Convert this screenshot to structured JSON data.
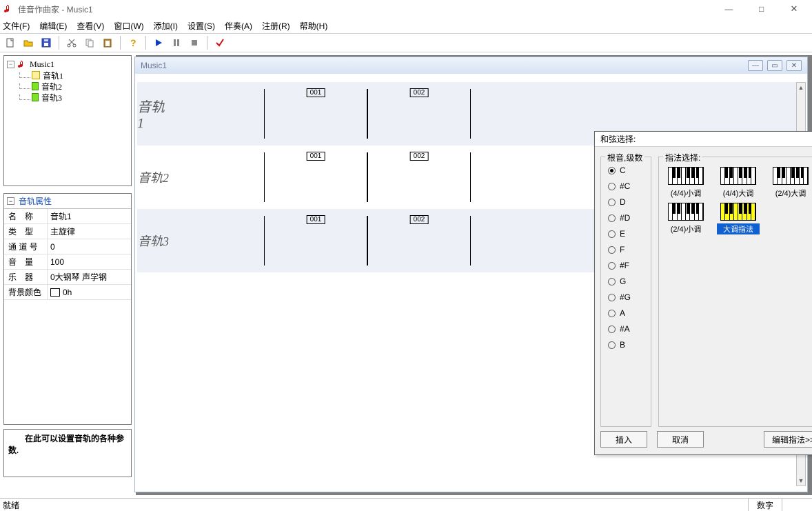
{
  "app": {
    "title": "佳音作曲家 - Music1"
  },
  "window_buttons": {
    "min": "—",
    "max": "□",
    "close": "✕"
  },
  "menu": {
    "file": "文件(F)",
    "edit": "编辑(E)",
    "view": "查看(V)",
    "window": "窗口(W)",
    "add": "添加(I)",
    "setup": "设置(S)",
    "accomp": "伴奏(A)",
    "reg": "注册(R)",
    "help": "帮助(H)"
  },
  "tree": {
    "root": "Music1",
    "items": [
      "音轨1",
      "音轨2",
      "音轨3"
    ]
  },
  "props": {
    "title": "音轨属性",
    "rows": {
      "name": {
        "k": "名　称",
        "v": "音轨1"
      },
      "type": {
        "k": "类　型",
        "v": "主旋律"
      },
      "chan": {
        "k": "通 道 号",
        "v": "0"
      },
      "vol": {
        "k": "音　量",
        "v": "100"
      },
      "instr": {
        "k": "乐　器",
        "v": "0大钢琴 声学钢"
      },
      "bg": {
        "k": "背景颜色",
        "v": "0h"
      }
    }
  },
  "hint": "　　在此可以设置音轨的各种参数.",
  "child": {
    "title": "Music1",
    "tracks": [
      {
        "label": "音轨1",
        "measures": [
          "001",
          "002"
        ]
      },
      {
        "label": "音轨2",
        "measures": [
          "001",
          "002"
        ]
      },
      {
        "label": "音轨3",
        "measures": [
          "001",
          "002"
        ]
      }
    ]
  },
  "dialog": {
    "title": "和弦选择:",
    "root_legend": "根音,级数",
    "roots": [
      "C",
      "#C",
      "D",
      "#D",
      "E",
      "F",
      "#F",
      "G",
      "#G",
      "A",
      "#A",
      "B"
    ],
    "root_selected": "C",
    "fin_legend": "指法选择:",
    "fingerings": [
      {
        "label": "(4/4)小调"
      },
      {
        "label": "(4/4)大调"
      },
      {
        "label": "(2/4)大调"
      },
      {
        "label": "(2/4)小调"
      },
      {
        "label": "大调指法",
        "selected": true
      }
    ],
    "buttons": {
      "insert": "插入",
      "cancel": "取消",
      "edit": "编辑指法>>"
    }
  },
  "status": {
    "ready": "就绪",
    "num": "数字"
  }
}
